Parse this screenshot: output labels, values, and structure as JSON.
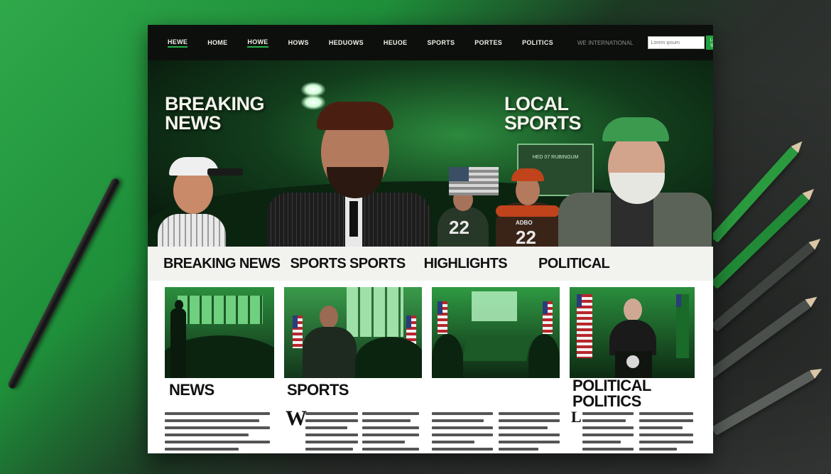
{
  "nav": {
    "items": [
      "HEWE",
      "HOME",
      "HOWE",
      "HOWS",
      "HEDUOWS",
      "HEUOE",
      "SPORTS",
      "PORTES",
      "POLITICS"
    ],
    "aux": "WE  INTERNATIONAL",
    "search_placeholder": "Lorem ipsum",
    "search_button": "Lorem ipsum"
  },
  "hero": {
    "left_title": "BREAKING\nNEWS",
    "right_title": "LOCAL\nSPORTS",
    "scoreboard_text": "HED 07 RUBINGUM",
    "jersey_numbers": [
      "22",
      "22"
    ],
    "cap_text": "ADBO"
  },
  "sections": [
    "BREAKING NEWS",
    "SPORTS SPORTS",
    "HIGHLIGHTS",
    "POLITICAL"
  ],
  "cards": [
    {
      "title": "NEWS",
      "dropcap": ""
    },
    {
      "title": "SPORTS",
      "dropcap": "W"
    },
    {
      "title": "",
      "dropcap": ""
    },
    {
      "title": "POLITICAL\nPOLITICS",
      "dropcap": "L"
    }
  ],
  "colors": {
    "accent": "#1fa13c",
    "nav_bg": "#0d0f0d",
    "hero_green": "#2c8a3d"
  }
}
